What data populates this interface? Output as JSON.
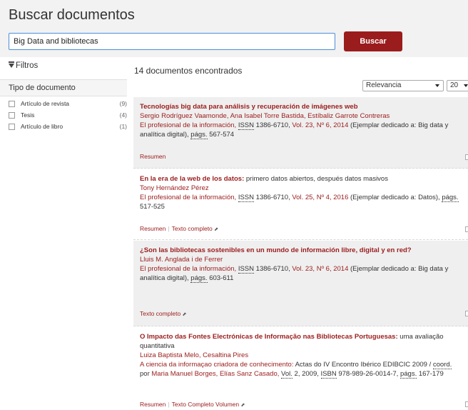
{
  "header": {
    "title": "Buscar documentos",
    "search_value": "Big Data and bibliotecas",
    "search_button": "Buscar"
  },
  "filters": {
    "label": "Filtros",
    "section_title": "Tipo de documento",
    "items": [
      {
        "label": "Artículo de revista",
        "count": "(9)"
      },
      {
        "label": "Tesis",
        "count": "(4)"
      },
      {
        "label": "Artículo de libro",
        "count": "(1)"
      }
    ]
  },
  "results_summary": "14 documentos encontrados",
  "sort": {
    "selected": "Relevancia"
  },
  "per_page": {
    "selected": "20"
  },
  "results": [
    {
      "title": "Tecnologías big data para análisis y recuperación de imágenes web",
      "title_sub": "",
      "authors": "Sergio Rodríguez Vaamonde, Ana Isabel Torre Bastida, Estíbaliz Garrote Contreras",
      "journal": "El profesional de la información,",
      "issn_label": "ISSN",
      "issn": "1386-6710,",
      "volume": "Vol. 23, Nº 6, 2014",
      "extra": "(Ejemplar dedicado a: Big data y analítica digital),",
      "pags_label": "págs.",
      "pages": "567-574",
      "links": [
        "Resumen"
      ]
    },
    {
      "title": "En la era de la web de los datos:",
      "title_sub": "primero datos abiertos, después datos masivos",
      "authors": "Tony Hernández Pérez",
      "journal": "El profesional de la información,",
      "issn_label": "ISSN",
      "issn": "1386-6710,",
      "volume": "Vol. 25, Nº 4, 2016",
      "extra": "(Ejemplar dedicado a: Datos),",
      "pags_label": "págs.",
      "pages": "517-525",
      "links": [
        "Resumen",
        "Texto completo"
      ]
    },
    {
      "title": "¿Son las bibliotecas sostenibles en un mundo de información libre, digital y en red?",
      "title_sub": "",
      "authors": "Lluis M. Anglada i de Ferrer",
      "journal": "El profesional de la información,",
      "issn_label": "ISSN",
      "issn": "1386-6710,",
      "volume": "Vol. 23, Nº 6, 2014",
      "extra": "(Ejemplar dedicado a: Big data y analítica digital),",
      "pags_label": "págs.",
      "pages": "603-611",
      "links": [
        "Texto completo"
      ]
    },
    {
      "title": "O Impacto das Fontes Electrónicas de Informação nas Bibliotecas Portuguesas:",
      "title_sub": "uma avaliação quantitativa",
      "authors": "Luiza Baptista Melo, Cesaltina Pires",
      "book": "A ciencia da informaçao criadora de conhecimento:",
      "book_rest": "Actas do IV Encontro Ibérico EDIBCIC 2009 /",
      "coord": "coord.",
      "por": "por",
      "editors": "Maria Manuel Borges, Elías Sanz Casado,",
      "vol_label": "Vol.",
      "vol_rest": "2, 2009,",
      "isbn_label": "ISBN",
      "isbn": "978-989-26-0014-7,",
      "pags_label": "págs.",
      "pages": "167-179",
      "links": [
        "Resumen",
        "Texto Completo Volumen"
      ]
    }
  ]
}
